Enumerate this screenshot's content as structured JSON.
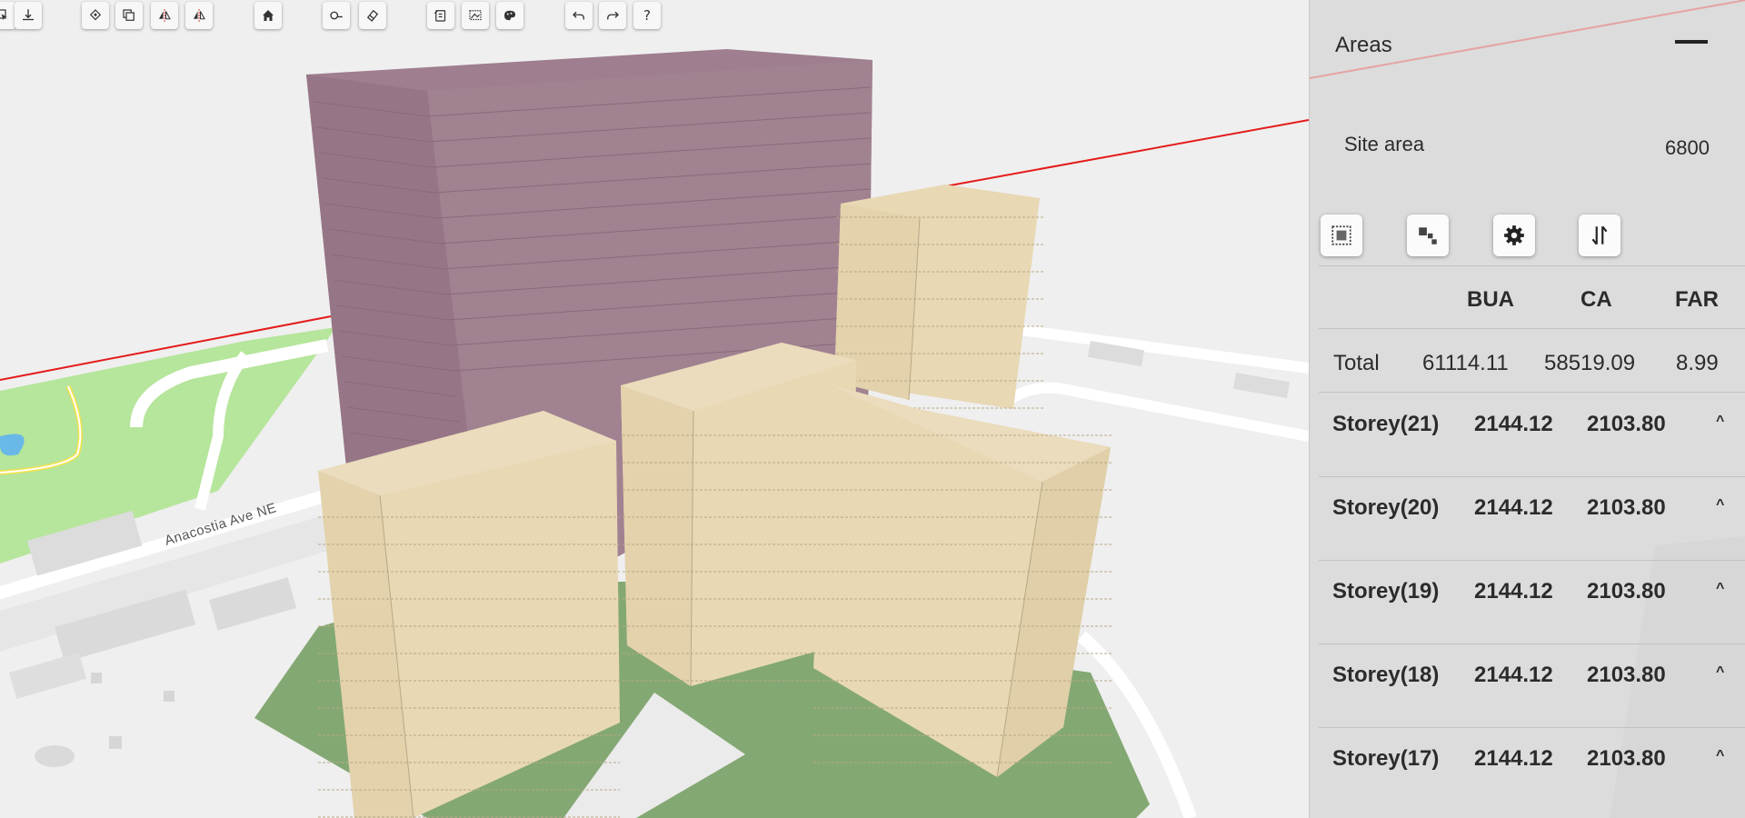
{
  "toolbar": {
    "buttons": [
      {
        "name": "select-tool-button",
        "icon": "select-icon"
      },
      {
        "name": "move-down-button",
        "icon": "move-down-icon"
      },
      {
        "name": "rotate-button",
        "icon": "rotate-icon"
      },
      {
        "name": "copy-button",
        "icon": "copy-icon"
      },
      {
        "name": "mirror-x-button",
        "icon": "mirror-icon"
      },
      {
        "name": "mirror-y-button",
        "icon": "mirror-icon"
      },
      {
        "name": "home-button",
        "icon": "home-icon"
      },
      {
        "name": "measure-button",
        "icon": "measure-icon"
      },
      {
        "name": "eraser-button",
        "icon": "eraser-icon"
      },
      {
        "name": "clipboard-button",
        "icon": "clipboard-icon"
      },
      {
        "name": "image-edit-button",
        "icon": "image-edit-icon"
      },
      {
        "name": "palette-button",
        "icon": "palette-icon"
      },
      {
        "name": "undo-button",
        "icon": "undo-icon"
      },
      {
        "name": "redo-button",
        "icon": "redo-icon"
      },
      {
        "name": "help-button",
        "icon": "help-icon",
        "label": "?"
      }
    ]
  },
  "map": {
    "street_label": "Anacostia Ave NE"
  },
  "colors": {
    "tower": "#9e7e8f",
    "building": "#e8d8b4",
    "ground": "#84a873",
    "park": "#b6e59c",
    "road": "#ffffff",
    "site_boundary": "#e41b1b",
    "panel_bg": "#dcdcdc"
  },
  "panel": {
    "title": "Areas",
    "site_area_label": "Site area",
    "site_area_value": "6800",
    "tools": [
      {
        "name": "area-grid-button",
        "icon": "grid-icon"
      },
      {
        "name": "blocks-button",
        "icon": "blocks-icon"
      },
      {
        "name": "settings-button",
        "icon": "gear-icon"
      },
      {
        "name": "sort-button",
        "icon": "sort-icon"
      }
    ],
    "columns": {
      "bua": "BUA",
      "ca": "CA",
      "far": "FAR"
    },
    "total": {
      "label": "Total",
      "bua": "61114.11",
      "ca": "58519.09",
      "far": "8.99"
    },
    "storeys": [
      {
        "label": "Storey(21)",
        "bua": "2144.12",
        "ca": "2103.80",
        "toggle": "^"
      },
      {
        "label": "Storey(20)",
        "bua": "2144.12",
        "ca": "2103.80",
        "toggle": "^"
      },
      {
        "label": "Storey(19)",
        "bua": "2144.12",
        "ca": "2103.80",
        "toggle": "^"
      },
      {
        "label": "Storey(18)",
        "bua": "2144.12",
        "ca": "2103.80",
        "toggle": "^"
      },
      {
        "label": "Storey(17)",
        "bua": "2144.12",
        "ca": "2103.80",
        "toggle": "^"
      }
    ]
  }
}
